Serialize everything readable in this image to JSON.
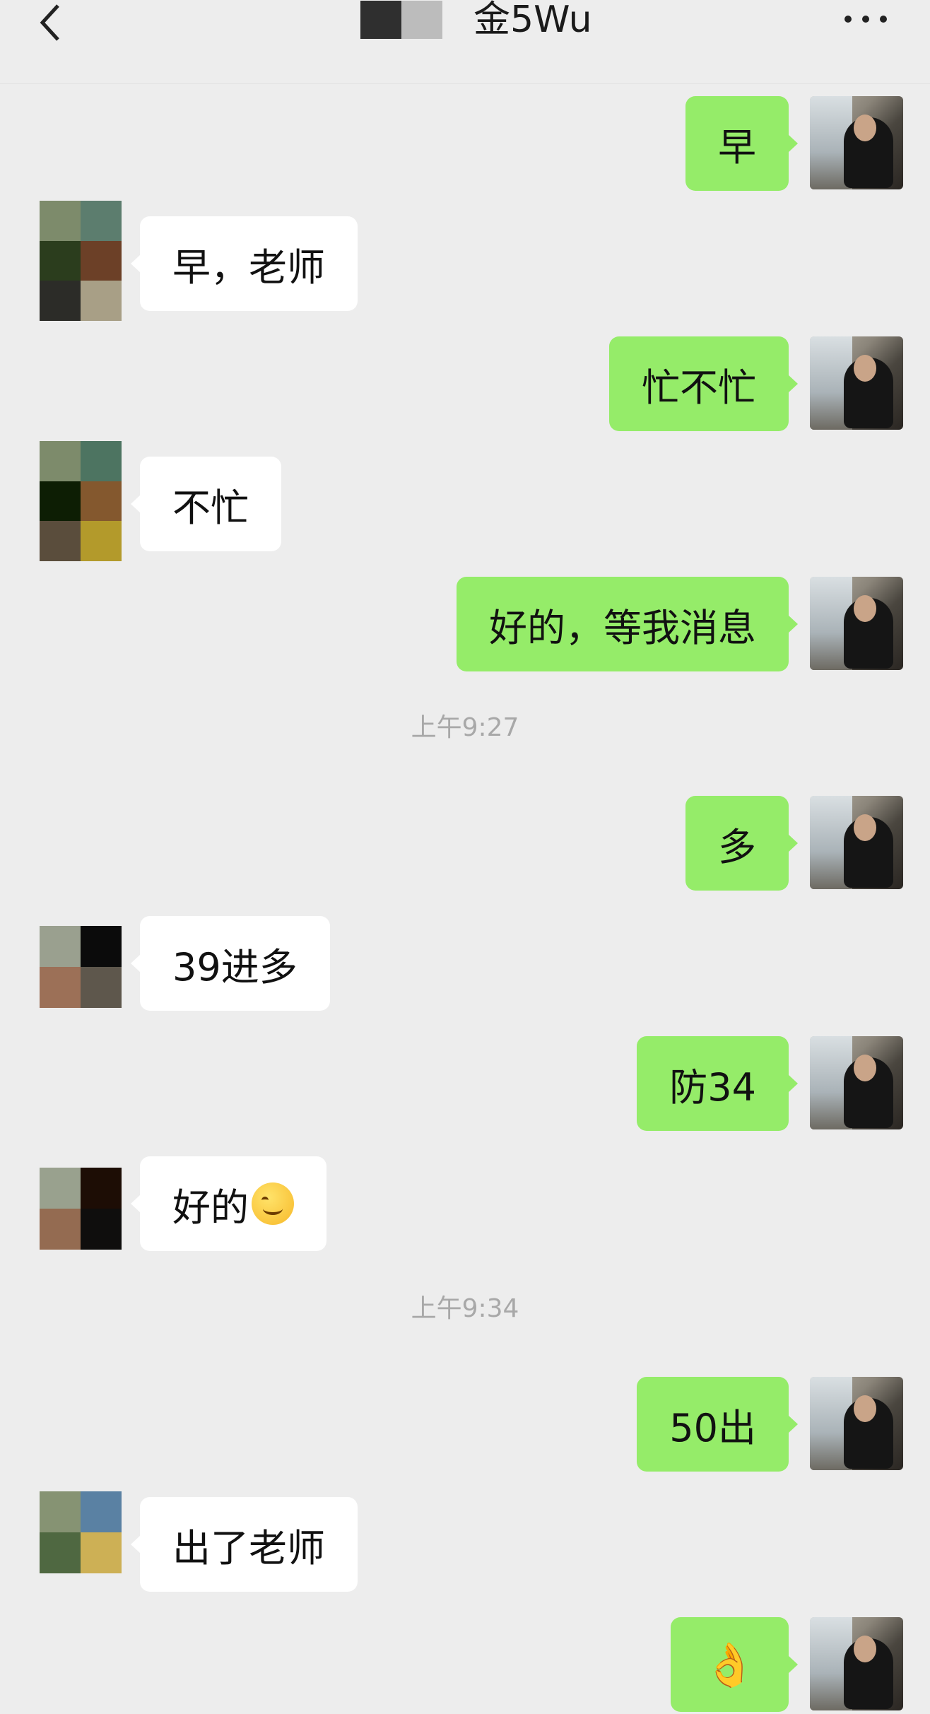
{
  "header": {
    "title": "金5Wu",
    "back_icon": "chevron-left-icon",
    "more_icon": "more-dots-icon"
  },
  "colors": {
    "background": "#ededed",
    "my_bubble": "#95ec69",
    "other_bubble": "#ffffff",
    "timestamp": "#a8a8a8"
  },
  "messages": [
    {
      "side": "me",
      "text": "早"
    },
    {
      "side": "other",
      "text": "早，老师"
    },
    {
      "side": "me",
      "text": "忙不忙"
    },
    {
      "side": "other",
      "text": "不忙"
    },
    {
      "side": "me",
      "text": "好的，等我消息"
    },
    {
      "type": "time",
      "text": "上午9:27"
    },
    {
      "side": "me",
      "text": "多"
    },
    {
      "side": "other",
      "text": "39进多"
    },
    {
      "side": "me",
      "text": "防34"
    },
    {
      "side": "other",
      "text": "好的",
      "emoji": "smiling-face-emoji"
    },
    {
      "type": "time",
      "text": "上午9:34"
    },
    {
      "side": "me",
      "text": "50出"
    },
    {
      "side": "other",
      "text": "出了老师"
    },
    {
      "side": "me",
      "text": "👌",
      "emoji": "ok-hand-emoji"
    }
  ]
}
